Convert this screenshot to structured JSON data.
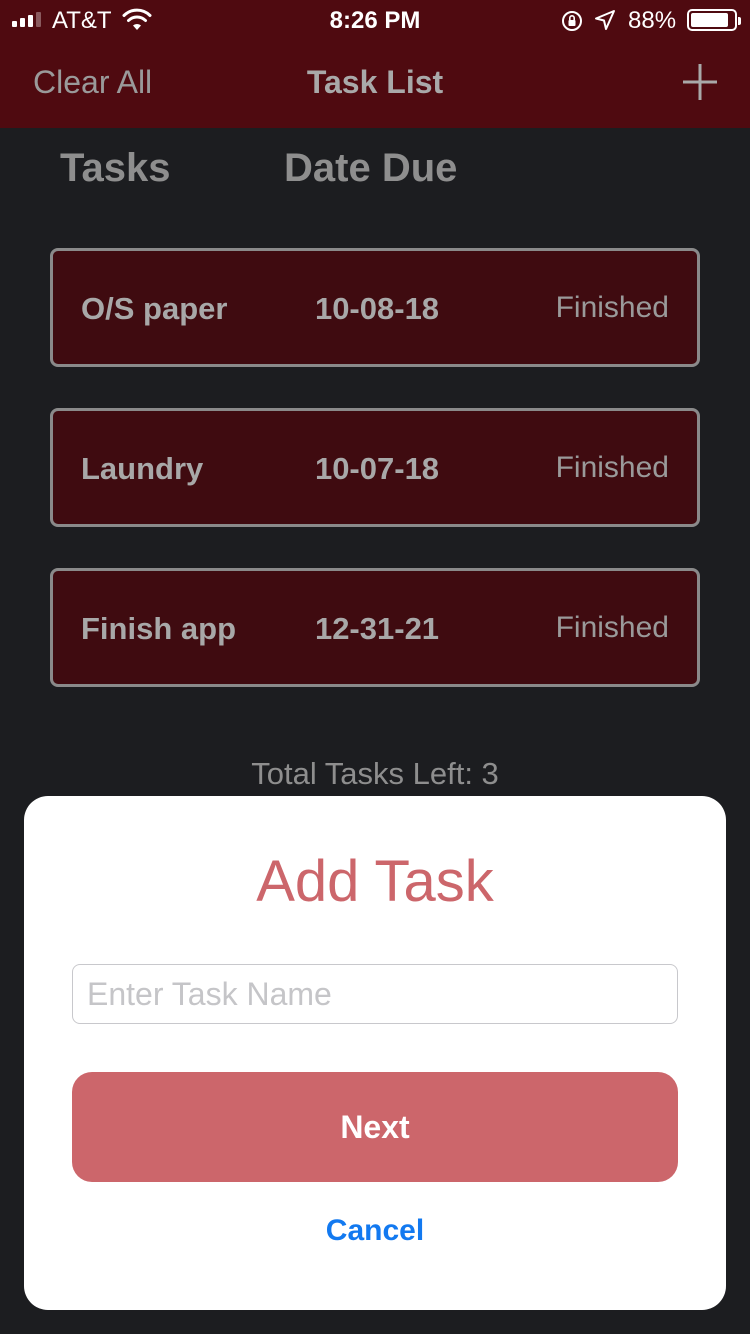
{
  "status_bar": {
    "carrier": "AT&T",
    "time": "8:26 PM",
    "battery_percent": "88%",
    "battery_level": 0.88,
    "signal_bars": 3
  },
  "nav": {
    "left_label": "Clear All",
    "title": "Task List",
    "right_icon": "plus-icon"
  },
  "columns": {
    "tasks": "Tasks",
    "date_due": "Date Due"
  },
  "tasks": [
    {
      "name": "O/S paper",
      "date": "10-08-18",
      "status": "Finished"
    },
    {
      "name": "Laundry",
      "date": "10-07-18",
      "status": "Finished"
    },
    {
      "name": "Finish app",
      "date": "12-31-21",
      "status": "Finished"
    }
  ],
  "total_label": "Total Tasks Left: 3",
  "modal": {
    "title": "Add Task",
    "input_placeholder": "Enter Task Name",
    "input_value": "",
    "next_label": "Next",
    "cancel_label": "Cancel"
  },
  "colors": {
    "nav_background": "#4f0a10",
    "row_background": "#3f0b10",
    "accent": "#cc666b",
    "link": "#1279f0"
  }
}
